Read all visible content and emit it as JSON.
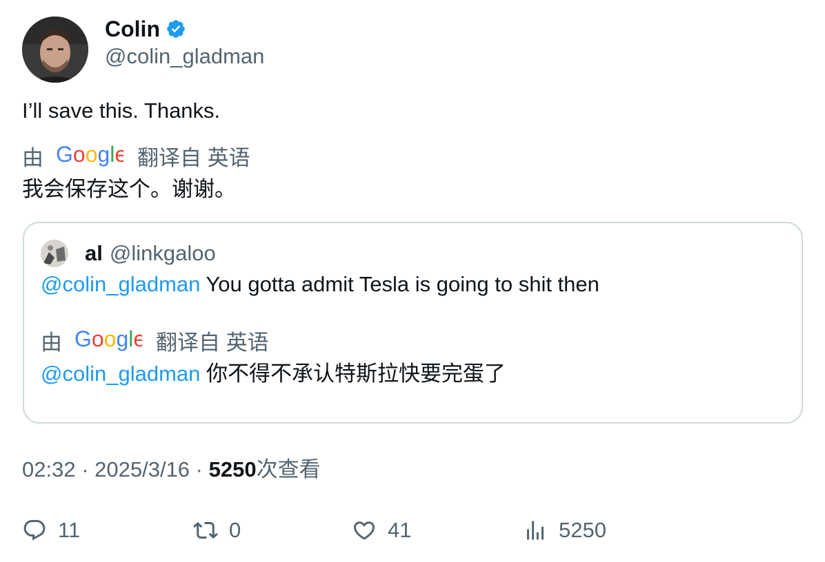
{
  "author": {
    "display_name": "Colin",
    "handle": "@colin_gladman",
    "verified_icon": "verified-badge-icon"
  },
  "tweet": {
    "text": "I’ll save this. Thanks.",
    "translation_by": "由",
    "translation_brand": "Google",
    "translation_from": "翻译自 英语",
    "translated_text": "我会保存这个。谢谢。"
  },
  "quote": {
    "display_name": "al",
    "handle": "@linkgaloo",
    "mention": "@colin_gladman",
    "text": " You gotta admit Tesla is going to shit then",
    "translation_by": "由",
    "translation_brand": "Google",
    "translation_from": "翻译自 英语",
    "translated_mention": "@colin_gladman",
    "translated_text": " 你不得不承认特斯拉快要完蛋了"
  },
  "meta": {
    "time": "02:32",
    "sep1": " · ",
    "date": "2025/3/16",
    "sep2": " · ",
    "views_count": "5250",
    "views_label": "次查看"
  },
  "actions": {
    "reply_count": "11",
    "retweet_count": "0",
    "like_count": "41",
    "views_count": "5250"
  },
  "colors": {
    "link": "#1d9bf0",
    "secondary_text": "#536471",
    "border": "#cfd9de"
  }
}
